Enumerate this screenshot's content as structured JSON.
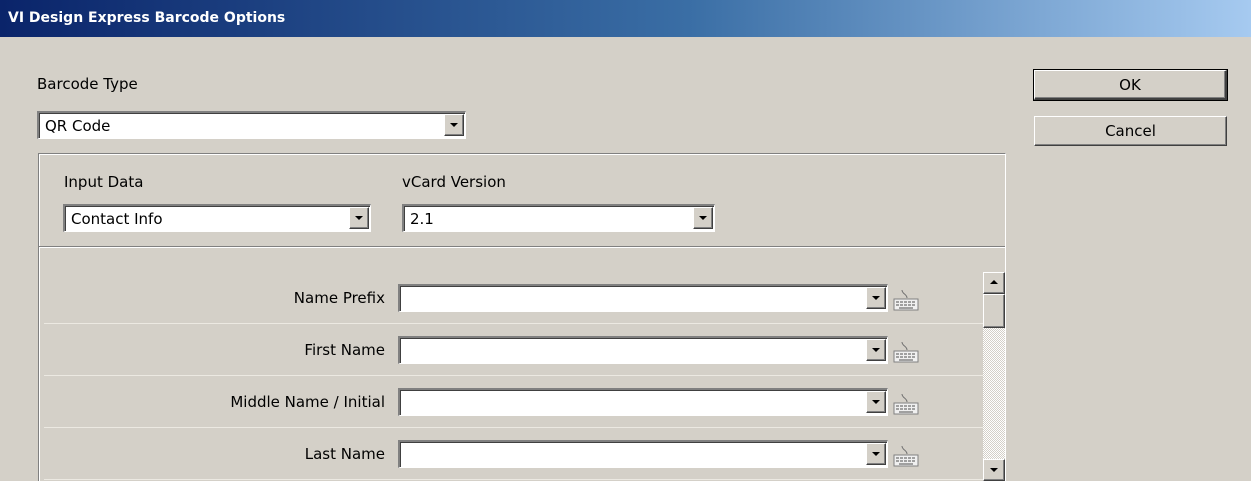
{
  "window": {
    "title": "VI Design Express Barcode Options"
  },
  "barcode_type": {
    "label": "Barcode Type",
    "value": "QR Code"
  },
  "buttons": {
    "ok": "OK",
    "cancel": "Cancel"
  },
  "input_data": {
    "label": "Input Data",
    "value": "Contact Info"
  },
  "vcard_version": {
    "label": "vCard Version",
    "value": "2.1"
  },
  "fields": [
    {
      "label": "Name Prefix",
      "value": "",
      "icon": "keyboard-icon"
    },
    {
      "label": "First Name",
      "value": "",
      "icon": "keyboard-icon"
    },
    {
      "label": "Middle Name / Initial",
      "value": "",
      "icon": "keyboard-icon"
    },
    {
      "label": "Last Name",
      "value": "",
      "icon": "keyboard-icon"
    }
  ]
}
